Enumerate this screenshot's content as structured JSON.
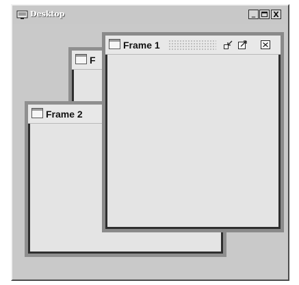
{
  "window": {
    "title": "Desktop",
    "minimize_label": "_",
    "maximize_label": "□",
    "close_label": "X"
  },
  "frames": [
    {
      "title": "Frame 1",
      "state": "active"
    },
    {
      "title": "Frame 2",
      "state": "inactive"
    },
    {
      "title": "F",
      "state": "inactive"
    }
  ],
  "colors": {
    "desktop_bg": "#c9c9c9",
    "frame_bg": "#e4e4e4",
    "frame_border": "#8f8f8f"
  }
}
